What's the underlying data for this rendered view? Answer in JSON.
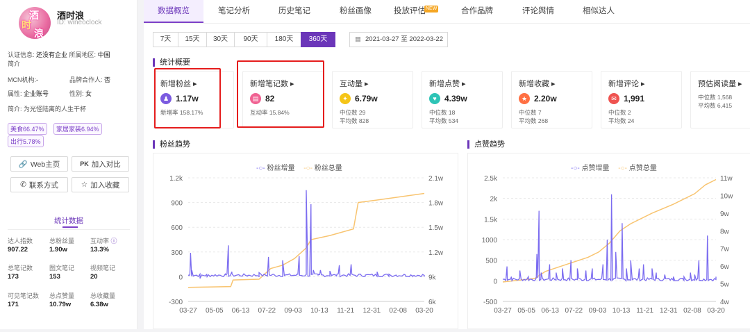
{
  "profile": {
    "name": "酒时浪",
    "id": "ID: wineoclock",
    "avatar_chars": [
      "酒",
      "时",
      "浪"
    ],
    "cert": "认证信息: ",
    "cert_val": "还没有企业",
    "region": "所属地区: ",
    "region_val": "中国",
    "intro_label": "简介",
    "mcn": "MCN机构:",
    "mcn_val": "-",
    "brand": "品牌合作人: ",
    "brand_val": "否",
    "attr": "属性: ",
    "attr_val": "企业账号",
    "gender": "性别: ",
    "gender_val": "女",
    "bio": "简介: 为光怪陆离的人生干杯",
    "tags": [
      "美食66.47%",
      "家居家装6.94%",
      "出行5.78%"
    ],
    "buttons": {
      "web": "Web主页",
      "compare": "加入对比",
      "contact": "联系方式",
      "fav": "加入收藏"
    },
    "stats_title": "统计数据",
    "stats": [
      {
        "label": "达人指数",
        "value": "907.22"
      },
      {
        "label": "总粉丝量",
        "value": "1.90w"
      },
      {
        "label": "互动率",
        "value": "13.3%"
      },
      {
        "label": "总笔记数",
        "value": "173"
      },
      {
        "label": "图文笔记",
        "value": "153"
      },
      {
        "label": "视频笔记",
        "value": "20"
      },
      {
        "label": "可见笔记数",
        "value": "171"
      },
      {
        "label": "总点赞量",
        "value": "10.79w"
      },
      {
        "label": "总收藏量",
        "value": "6.38w"
      }
    ]
  },
  "tabs": [
    "数据概览",
    "笔记分析",
    "历史笔记",
    "粉丝画像",
    "投放评估",
    "合作品牌",
    "评论舆情",
    "相似达人"
  ],
  "new_badge": "NEW",
  "ranges": [
    "7天",
    "15天",
    "30天",
    "90天",
    "180天",
    "360天"
  ],
  "date_range": {
    "start": "2021-03-27",
    "sep": "至",
    "end": "2022-03-22"
  },
  "overview_title": "统计概要",
  "cards": [
    {
      "title": "新增粉丝 ▸",
      "value": "1.17w",
      "sub1": "新增率 158.17%",
      "sub2": "",
      "color": "#7b5be0",
      "icon": "fans-icon",
      "glyph": "♟"
    },
    {
      "title": "新增笔记数 ▸",
      "value": "82",
      "sub1": "互动率 15.84%",
      "sub2": "",
      "color": "#f06292",
      "icon": "note-icon",
      "glyph": "▤"
    },
    {
      "title": "互动量 ▸",
      "value": "6.79w",
      "sub1": "中位数 29",
      "sub2": "平均数 828",
      "color": "#f5c518",
      "icon": "bulb-icon",
      "glyph": "✦"
    },
    {
      "title": "新增点赞 ▸",
      "value": "4.39w",
      "sub1": "中位数 18",
      "sub2": "平均数 534",
      "color": "#2ec4b6",
      "icon": "thumb-icon",
      "glyph": "♥"
    },
    {
      "title": "新增收藏 ▸",
      "value": "2.20w",
      "sub1": "中位数 7",
      "sub2": "平均数 268",
      "color": "#ff7043",
      "icon": "collect-icon",
      "glyph": "★"
    },
    {
      "title": "新增评论 ▸",
      "value": "1,991",
      "sub1": "中位数 2",
      "sub2": "平均数 24",
      "color": "#ef5350",
      "icon": "comment-icon",
      "glyph": "✉"
    },
    {
      "title": "预估阅读量 ▸",
      "value": "",
      "sub1": "中位数 1,568",
      "sub2": "平均数 6,415",
      "color": "#999999",
      "icon": "",
      "glyph": ""
    }
  ],
  "chart_data": [
    {
      "type": "line",
      "title": "粉丝趋势",
      "x_ticks": [
        "03-27",
        "05-05",
        "06-13",
        "07-22",
        "09-03",
        "10-13",
        "11-21",
        "12-31",
        "02-08",
        "03-20"
      ],
      "left_axis": {
        "ticks": [
          "1.2k",
          "900",
          "600",
          "300",
          "0",
          "-300"
        ],
        "range": [
          -300,
          1200
        ]
      },
      "right_axis": {
        "ticks": [
          "2.1w",
          "1.8w",
          "1.5w",
          "1.2w",
          "9k",
          "6k"
        ],
        "range": [
          6000,
          21000
        ]
      },
      "series": [
        {
          "name": "粉丝增量",
          "color": "#7b6cf0",
          "peaks": [
            [
              0.01,
              290
            ],
            [
              0.015,
              80
            ],
            [
              0.05,
              -20
            ],
            [
              0.08,
              0
            ],
            [
              0.16,
              20
            ],
            [
              0.17,
              380
            ],
            [
              0.185,
              60
            ],
            [
              0.22,
              10
            ],
            [
              0.25,
              10
            ],
            [
              0.3,
              50
            ],
            [
              0.34,
              240
            ],
            [
              0.36,
              30
            ],
            [
              0.4,
              200
            ],
            [
              0.43,
              30
            ],
            [
              0.46,
              30
            ],
            [
              0.47,
              250
            ],
            [
              0.5,
              1050
            ],
            [
              0.505,
              300
            ],
            [
              0.52,
              880
            ],
            [
              0.53,
              80
            ],
            [
              0.55,
              20
            ],
            [
              0.56,
              80
            ],
            [
              0.6,
              70
            ],
            [
              0.63,
              30
            ],
            [
              0.64,
              140
            ],
            [
              0.66,
              20
            ],
            [
              0.69,
              150
            ],
            [
              0.72,
              20
            ],
            [
              0.75,
              20
            ],
            [
              0.8,
              60
            ],
            [
              0.85,
              30
            ],
            [
              0.88,
              20
            ],
            [
              0.92,
              20
            ],
            [
              0.95,
              10
            ],
            [
              1.0,
              0
            ]
          ]
        },
        {
          "name": "粉丝总量",
          "color": "#f8c470",
          "points": [
            [
              0,
              7700
            ],
            [
              0.18,
              7800
            ],
            [
              0.19,
              8600
            ],
            [
              0.3,
              8700
            ],
            [
              0.35,
              10000
            ],
            [
              0.4,
              10400
            ],
            [
              0.45,
              11200
            ],
            [
              0.5,
              12500
            ],
            [
              0.52,
              13500
            ],
            [
              0.6,
              14000
            ],
            [
              0.7,
              14800
            ],
            [
              0.72,
              18000
            ],
            [
              0.8,
              18300
            ],
            [
              0.9,
              18700
            ],
            [
              1.0,
              19100
            ]
          ]
        }
      ]
    },
    {
      "type": "line",
      "title": "点赞趋势",
      "x_ticks": [
        "03-27",
        "05-05",
        "06-13",
        "07-22",
        "09-03",
        "10-13",
        "11-21",
        "12-31",
        "02-08",
        "03-20"
      ],
      "left_axis": {
        "ticks": [
          "2.5k",
          "2k",
          "1.5k",
          "1000",
          "500",
          "0",
          "-500"
        ],
        "range": [
          -500,
          2500
        ]
      },
      "right_axis": {
        "ticks": [
          "11w",
          "10w",
          "9w",
          "8w",
          "7w",
          "6w",
          "5w",
          "4w"
        ],
        "range": [
          40000,
          110000
        ]
      },
      "series": [
        {
          "name": "点赞增量",
          "color": "#7b6cf0",
          "peaks": [
            [
              0.02,
              350
            ],
            [
              0.04,
              100
            ],
            [
              0.08,
              250
            ],
            [
              0.12,
              100
            ],
            [
              0.16,
              650
            ],
            [
              0.17,
              1700
            ],
            [
              0.18,
              200
            ],
            [
              0.22,
              400
            ],
            [
              0.25,
              200
            ],
            [
              0.28,
              300
            ],
            [
              0.32,
              500
            ],
            [
              0.35,
              300
            ],
            [
              0.39,
              250
            ],
            [
              0.42,
              300
            ],
            [
              0.47,
              400
            ],
            [
              0.49,
              1000
            ],
            [
              0.51,
              2100
            ],
            [
              0.53,
              700
            ],
            [
              0.56,
              1400
            ],
            [
              0.58,
              300
            ],
            [
              0.6,
              500
            ],
            [
              0.64,
              300
            ],
            [
              0.66,
              400
            ],
            [
              0.7,
              300
            ],
            [
              0.72,
              200
            ],
            [
              0.76,
              150
            ],
            [
              0.8,
              100
            ],
            [
              0.85,
              100
            ],
            [
              0.88,
              200
            ],
            [
              0.9,
              150
            ],
            [
              0.92,
              500
            ],
            [
              0.96,
              1100
            ],
            [
              1.0,
              100
            ]
          ]
        },
        {
          "name": "点赞总量",
          "color": "#f8c470",
          "points": [
            [
              0,
              51000
            ],
            [
              0.15,
              53000
            ],
            [
              0.2,
              57000
            ],
            [
              0.3,
              61000
            ],
            [
              0.4,
              65000
            ],
            [
              0.45,
              68000
            ],
            [
              0.5,
              73000
            ],
            [
              0.55,
              80000
            ],
            [
              0.6,
              84000
            ],
            [
              0.7,
              90000
            ],
            [
              0.8,
              95000
            ],
            [
              0.9,
              101000
            ],
            [
              0.95,
              106000
            ],
            [
              1.0,
              109000
            ]
          ]
        }
      ]
    }
  ]
}
